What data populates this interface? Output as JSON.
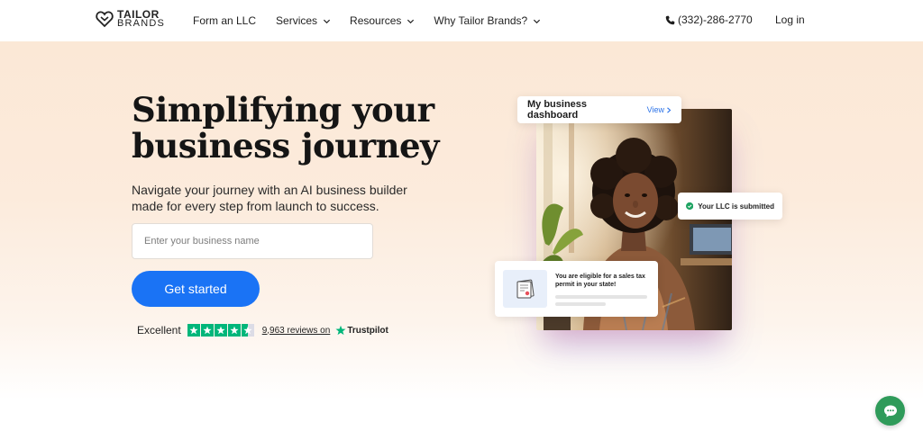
{
  "brand": {
    "name": "TAILOR",
    "name_sub": "BRANDS",
    "primary_color": "#1a73f5",
    "trustpilot_green": "#00b67a",
    "chat_color": "#2f9b5a"
  },
  "nav": {
    "items": [
      {
        "label": "Form an LLC",
        "has_dropdown": false
      },
      {
        "label": "Services",
        "has_dropdown": true
      },
      {
        "label": "Resources",
        "has_dropdown": true
      },
      {
        "label": "Why Tailor Brands?",
        "has_dropdown": true
      }
    ],
    "phone": "(332)-286-2770",
    "login_label": "Log in"
  },
  "hero": {
    "headline_line1": "Simplifying your",
    "headline_line2": "business journey",
    "subtext": "Navigate your journey with an AI business builder made for every step from launch to success.",
    "input_placeholder": "Enter your business name",
    "input_value": "",
    "cta_label": "Get started"
  },
  "rating": {
    "label": "Excellent",
    "stars": 4.5,
    "reviews_text": "9,963 reviews on",
    "provider": "Trustpilot"
  },
  "visual": {
    "dashboard_title": "My business dashboard",
    "dashboard_link": "View",
    "llc_status": "Your LLC is submitted",
    "tax_message": "You are eligible for a sales tax permit in your state!"
  },
  "icons": {
    "logo": "heart-shield-logo",
    "phone": "phone-icon",
    "chevron": "chevron-down-icon",
    "check": "check-circle-icon",
    "document": "certificate-icon",
    "chat": "chat-bubble-icon"
  }
}
